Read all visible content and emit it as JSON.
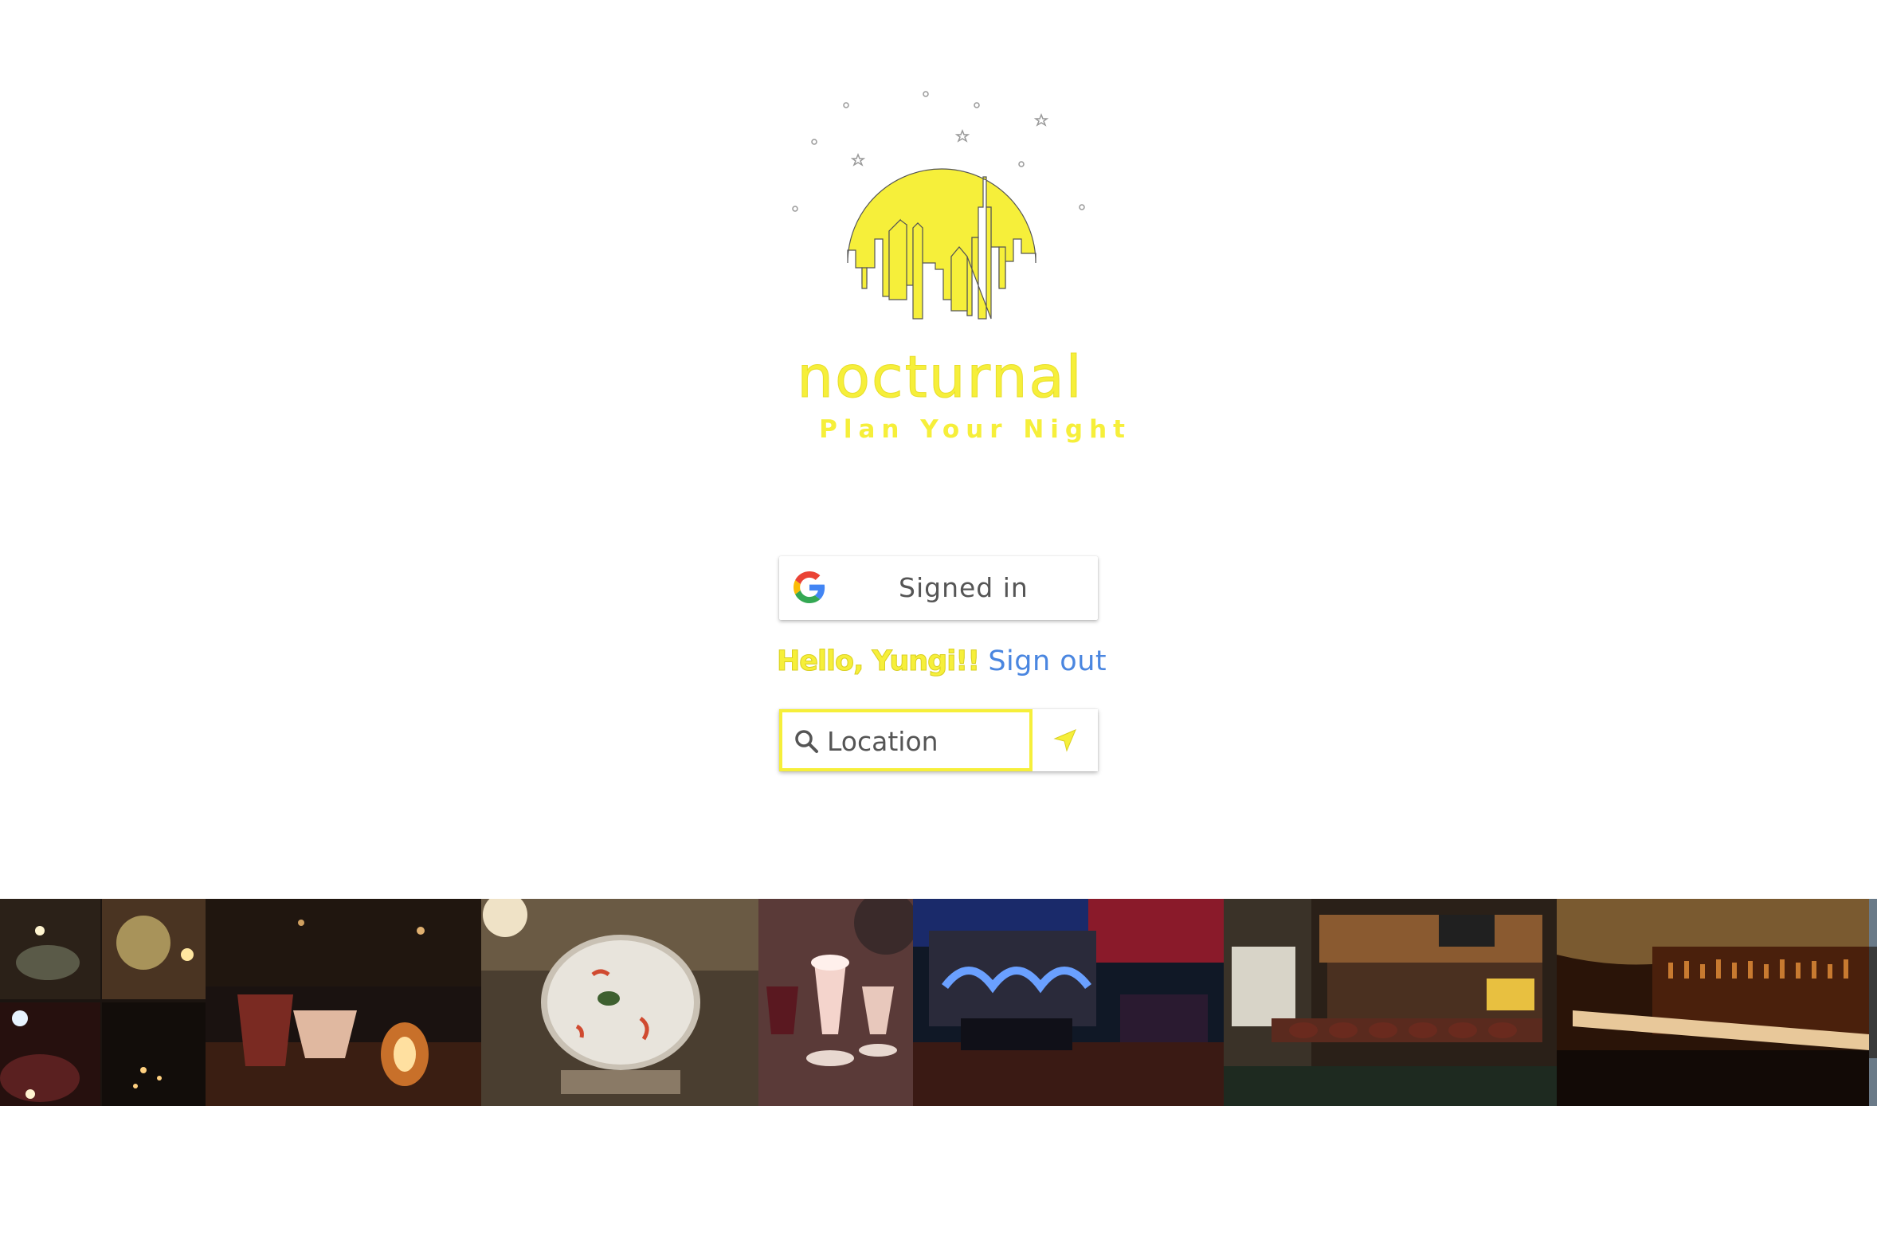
{
  "brand": {
    "name": "nocturnal",
    "tagline": "Plan Your Night",
    "accent_color": "#f6ef3a"
  },
  "auth": {
    "google_button_label": "Signed in",
    "greeting": "Hello, Yungi!!",
    "sign_out_label": "Sign out",
    "link_color": "#4a86e0"
  },
  "search": {
    "placeholder": "Location",
    "value": ""
  },
  "icons": {
    "logo": "moon-skyline-logo",
    "google": "google-g-icon",
    "search": "search-icon",
    "locate": "location-arrow-icon"
  },
  "gallery": {
    "photos": [
      {
        "name": "candlelit-bar-collage"
      },
      {
        "name": "cocktails-dark-bar"
      },
      {
        "name": "sour-cocktail-closeup"
      },
      {
        "name": "dessert-cocktails"
      },
      {
        "name": "neon-lounge"
      },
      {
        "name": "cocktail-bar-stools"
      },
      {
        "name": "tiki-bar"
      },
      {
        "name": "bar-edge"
      }
    ]
  }
}
